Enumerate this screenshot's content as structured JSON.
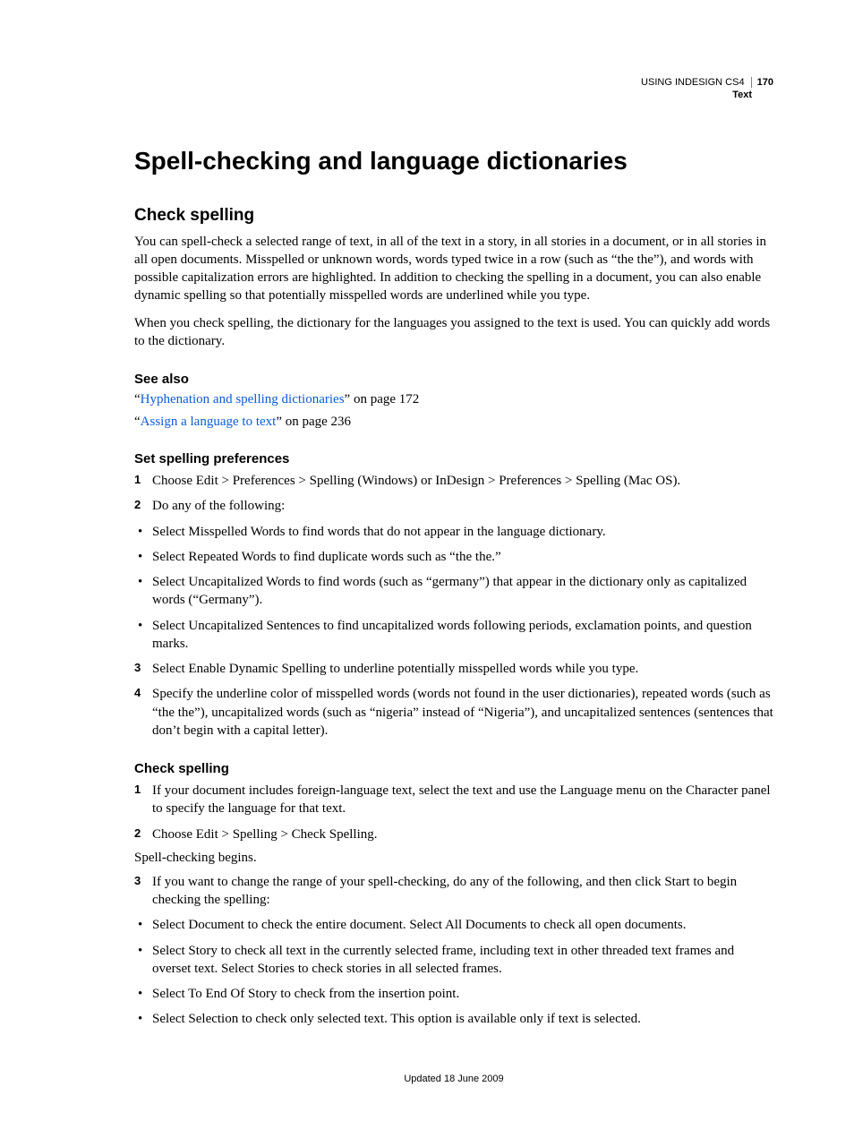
{
  "header": {
    "doc_title": "USING INDESIGN CS4",
    "section": "Text",
    "page_number": "170"
  },
  "chapter_title": "Spell-checking and language dictionaries",
  "section1": {
    "title": "Check spelling",
    "para1": "You can spell-check a selected range of text, in all of the text in a story, in all stories in a document, or in all stories in all open documents. Misspelled or unknown words, words typed twice in a row (such as “the the”), and words with possible capitalization errors are highlighted. In addition to checking the spelling in a document, you can also enable dynamic spelling so that potentially misspelled words are underlined while you type.",
    "para2": "When you check spelling, the dictionary for the languages you assigned to the text is used. You can quickly add words to the dictionary."
  },
  "see_also": {
    "title": "See also",
    "items": [
      {
        "pre": "“",
        "link": "Hyphenation and spelling dictionaries",
        "post": "” on page 172"
      },
      {
        "pre": "“",
        "link": "Assign a language to text",
        "post": "” on page 236"
      }
    ]
  },
  "sub1": {
    "title": "Set spelling preferences",
    "steps": [
      "Choose Edit > Preferences > Spelling (Windows) or InDesign > Preferences > Spelling (Mac OS).",
      "Do any of the following:"
    ],
    "bullets": [
      "Select Misspelled Words to find words that do not appear in the language dictionary.",
      "Select Repeated Words to find duplicate words such as “the the.”",
      "Select Uncapitalized Words to find words (such as “germany”) that appear in the dictionary only as capitalized words (“Germany”).",
      "Select Uncapitalized Sentences to find uncapitalized words following periods, exclamation points, and question marks."
    ],
    "steps_after": [
      "Select Enable Dynamic Spelling to underline potentially misspelled words while you type.",
      "Specify the underline color of misspelled words (words not found in the user dictionaries), repeated words (such as “the the”), uncapitalized words (such as “nigeria” instead of “Nigeria”), and uncapitalized sentences (sentences that don’t begin with a capital letter)."
    ]
  },
  "sub2": {
    "title": "Check spelling",
    "steps": [
      "If your document includes foreign-language text, select the text and use the Language menu on the Character panel to specify the language for that text.",
      "Choose Edit > Spelling > Check Spelling."
    ],
    "interjection": "Spell-checking begins.",
    "step3": "If you want to change the range of your spell-checking, do any of the following, and then click Start to begin checking the spelling:",
    "bullets": [
      "Select Document to check the entire document. Select All Documents to check all open documents.",
      "Select Story to check all text in the currently selected frame, including text in other threaded text frames and overset text. Select Stories to check stories in all selected frames.",
      "Select To End Of Story to check from the insertion point.",
      "Select Selection to check only selected text. This option is available only if text is selected."
    ]
  },
  "footer": "Updated 18 June 2009"
}
